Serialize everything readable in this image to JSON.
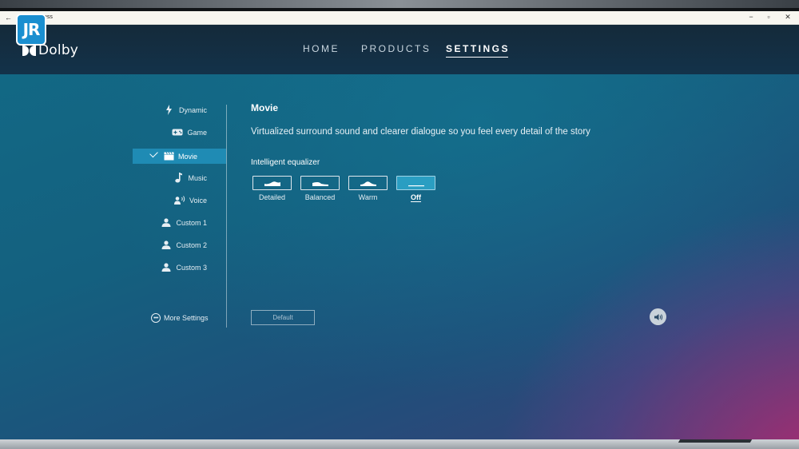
{
  "window": {
    "title": "ess",
    "back_glyph": "←",
    "controls": {
      "minimize": "−",
      "maximize": "▫",
      "close": "✕"
    }
  },
  "branding": {
    "badge_text": "JR",
    "logo_text": "Dolby"
  },
  "nav": {
    "home": "HOME",
    "products": "PRODUCTS",
    "settings": "SETTINGS",
    "active": "settings"
  },
  "sidebar": {
    "items": [
      {
        "label": "Dynamic",
        "icon": "lightning-icon"
      },
      {
        "label": "Game",
        "icon": "gamepad-icon"
      },
      {
        "label": "Movie",
        "icon": "clapperboard-icon",
        "selected": true
      },
      {
        "label": "Music",
        "icon": "music-note-icon"
      },
      {
        "label": "Voice",
        "icon": "voice-icon"
      },
      {
        "label": "Custom 1",
        "icon": "user-icon"
      },
      {
        "label": "Custom 2",
        "icon": "user-icon"
      },
      {
        "label": "Custom 3",
        "icon": "user-icon"
      }
    ],
    "more_settings": "More Settings"
  },
  "content": {
    "title": "Movie",
    "description": "Virtualized surround sound and clearer dialogue so you feel every detail of the story",
    "equalizer_label": "Intelligent equalizer",
    "equalizer_options": [
      {
        "label": "Detailed",
        "icon": "eq-detailed-icon"
      },
      {
        "label": "Balanced",
        "icon": "eq-balanced-icon"
      },
      {
        "label": "Warm",
        "icon": "eq-warm-icon"
      },
      {
        "label": "Off",
        "icon": "eq-off-icon",
        "active": true
      }
    ],
    "default_button": "Default",
    "volume_icon": "speaker-icon"
  },
  "colors": {
    "accent": "#1f8bb4",
    "eq_active": "#2a9ec2",
    "header_bg": "#13324a",
    "badge": "#1a8fd0"
  }
}
